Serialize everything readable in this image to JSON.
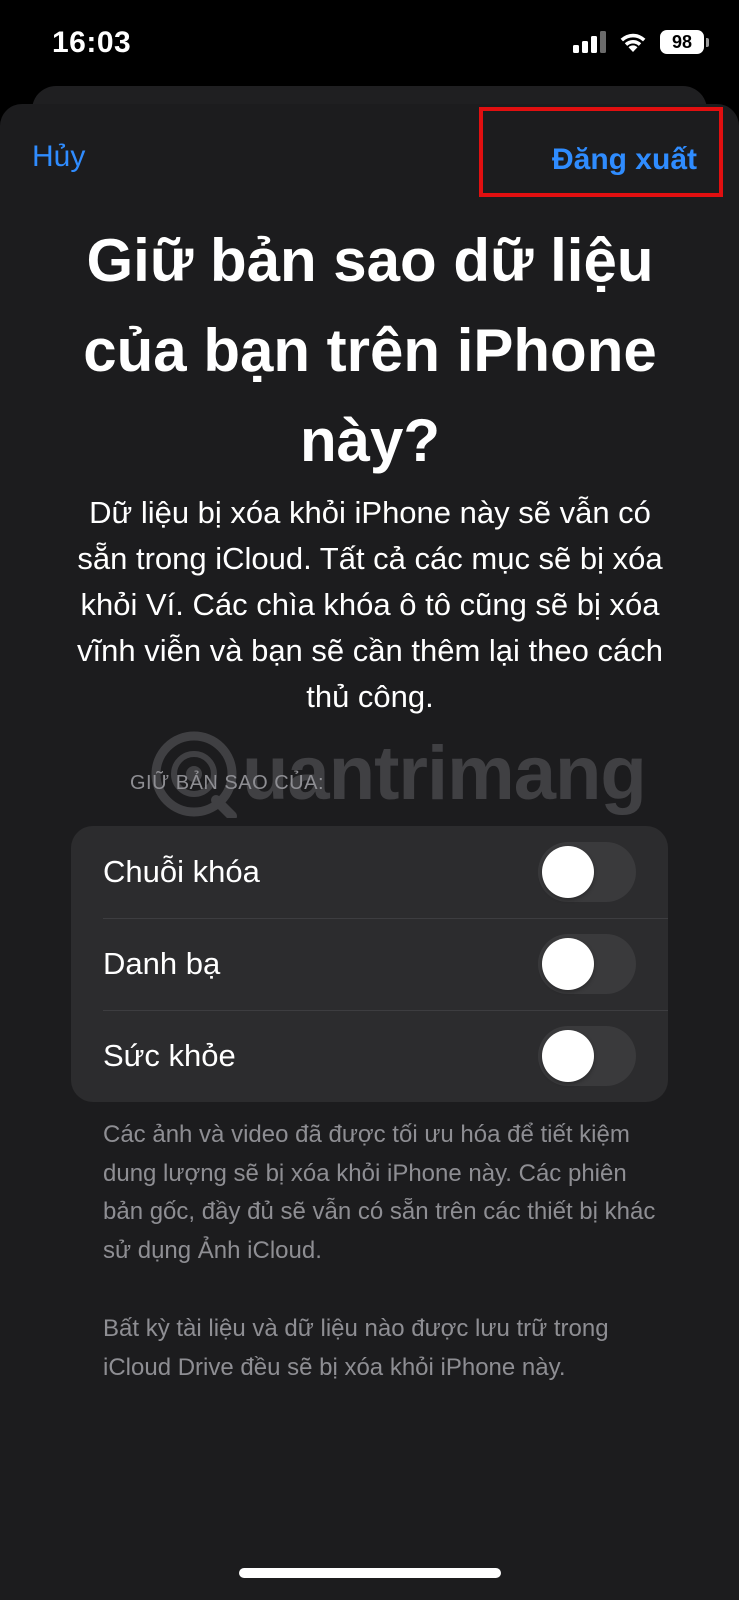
{
  "status_bar": {
    "time": "16:03",
    "battery": "98",
    "icons": [
      "cellular-signal-icon",
      "wifi-icon",
      "battery-icon"
    ]
  },
  "nav": {
    "cancel_label": "Hủy",
    "signout_label": "Đăng xuất"
  },
  "title": "Giữ bản sao dữ liệu của bạn trên iPhone này?",
  "description": "Dữ liệu bị xóa khỏi iPhone này sẽ vẫn có sẵn trong iCloud. Tất cả các mục sẽ bị xóa khỏi Ví. Các chìa khóa ô tô cũng sẽ bị xóa vĩnh viễn và bạn sẽ cần thêm lại theo cách thủ công.",
  "watermark": "uantrimang",
  "section_header": "GIỮ BẢN SAO CỦA:",
  "toggles": [
    {
      "label": "Chuỗi khóa",
      "on": false
    },
    {
      "label": "Danh bạ",
      "on": false
    },
    {
      "label": "Sức khỏe",
      "on": false
    }
  ],
  "notes": [
    "Các ảnh và video đã được tối ưu hóa để tiết kiệm dung lượng sẽ bị xóa khỏi iPhone này. Các phiên bản gốc, đầy đủ sẽ vẫn có sẵn trên các thiết bị khác sử dụng Ảnh iCloud.",
    "Bất kỳ tài liệu và dữ liệu nào được lưu trữ trong iCloud Drive đều sẽ bị xóa khỏi iPhone này."
  ],
  "colors": {
    "accent": "#2f8cff",
    "highlight_box": "#e10f10",
    "sheet_bg": "#1c1c1e",
    "group_bg": "#2c2c2e",
    "switch_off": "#3a3a3c"
  }
}
